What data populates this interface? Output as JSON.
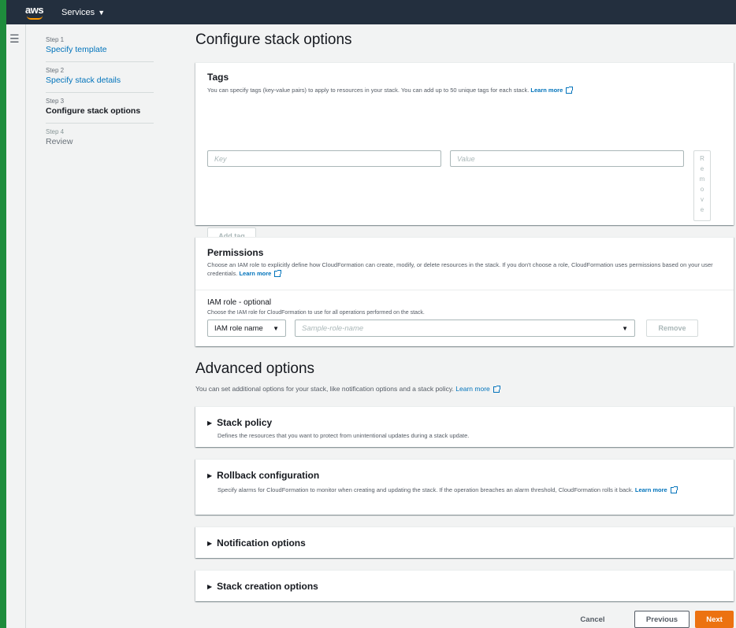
{
  "nav": {
    "logo": "aws",
    "services_label": "Services"
  },
  "steps": [
    {
      "num": "Step 1",
      "label": "Specify template"
    },
    {
      "num": "Step 2",
      "label": "Specify stack details"
    },
    {
      "num": "Step 3",
      "label": "Configure stack options"
    },
    {
      "num": "Step 4",
      "label": "Review"
    }
  ],
  "page_title": "Configure stack options",
  "tags": {
    "title": "Tags",
    "description": "You can specify tags (key-value pairs) to apply to resources in your stack. You can add up to 50 unique tags for each stack.",
    "learn_more": "Learn more",
    "key_placeholder": "Key",
    "value_placeholder": "Value",
    "remove_label": "Remove",
    "add_tag_label": "Add tag"
  },
  "permissions": {
    "title": "Permissions",
    "description": "Choose an IAM role to explicitly define how CloudFormation can create, modify, or delete resources in the stack. If you don't choose a role, CloudFormation uses permissions based on your user credentials.",
    "learn_more": "Learn more",
    "iam_label": "IAM role - optional",
    "iam_hint": "Choose the IAM role for CloudFormation to use for all operations performed on the stack.",
    "iam_type_value": "IAM role name",
    "role_placeholder": "Sample-role-name",
    "remove_label": "Remove"
  },
  "advanced": {
    "title": "Advanced options",
    "description": "You can set additional options for your stack, like notification options and a stack policy.",
    "learn_more": "Learn more",
    "stack_policy": {
      "title": "Stack policy",
      "description": "Defines the resources that you want to protect from unintentional updates during a stack update."
    },
    "rollback": {
      "title": "Rollback configuration",
      "description": "Specify alarms for CloudFormation to monitor when creating and updating the stack. If the operation breaches an alarm threshold, CloudFormation rolls it back.",
      "learn_more": "Learn more"
    },
    "notification": {
      "title": "Notification options"
    },
    "creation": {
      "title": "Stack creation options"
    }
  },
  "footer": {
    "cancel": "Cancel",
    "previous": "Previous",
    "next": "Next"
  },
  "colors": {
    "nav_bg": "#232f3e",
    "accent_orange": "#ec7211",
    "link_blue": "#0073bb",
    "stripe_green": "#1e8c3c"
  }
}
